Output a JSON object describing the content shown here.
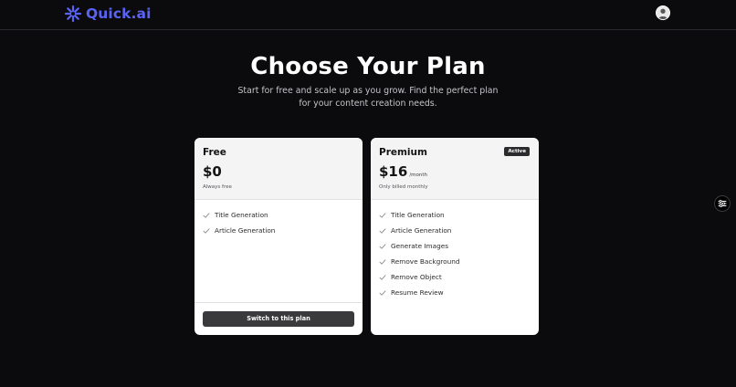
{
  "brand": {
    "name": "Quick.ai",
    "color": "#5a63f5",
    "logo_icon": "sparkle-asterisk-icon"
  },
  "header": {
    "avatar_icon": "user-avatar-icon"
  },
  "hero": {
    "title": "Choose Your Plan",
    "subtitle": "Start for free and scale up as you grow. Find the perfect plan for your content creation needs."
  },
  "plans": [
    {
      "name": "Free",
      "price": "$0",
      "period": "",
      "billing": "Always free",
      "badge": "",
      "features": [
        "Title Generation",
        "Article Generation"
      ],
      "action_label": "Switch to this plan"
    },
    {
      "name": "Premium",
      "price": "$16",
      "period": "/month",
      "billing": "Only billed monthly",
      "badge": "Active",
      "features": [
        "Title Generation",
        "Article Generation",
        "Generate Images",
        "Remove Background",
        "Remove Object",
        "Resume Review"
      ],
      "action_label": ""
    }
  ],
  "floating_button": {
    "icon": "sliders-icon"
  }
}
